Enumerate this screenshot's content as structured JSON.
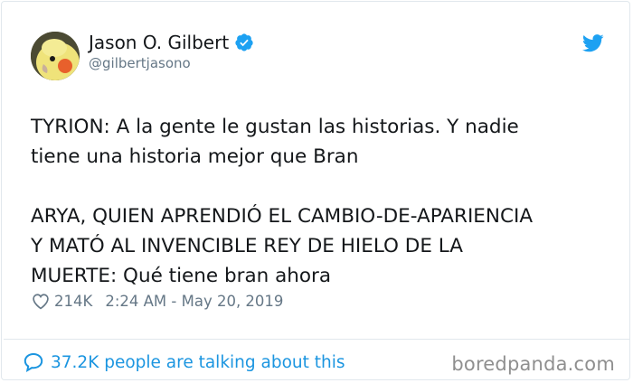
{
  "author": {
    "name": "Jason O. Gilbert",
    "handle": "@gilbertjasono",
    "avatar_icon": "cockatiel-avatar",
    "verified_icon": "verified-badge-icon",
    "verified_color": "#1da1f2"
  },
  "platform_icon": "twitter-bird-icon",
  "tweet": {
    "lines_1": [
      "TYRION: A la gente le gustan las historias. Y nadie",
      "tiene una historia mejor que Bran"
    ],
    "lines_2": [
      "ARYA, QUIEN APRENDIÓ EL CAMBIO-DE-APARIENCIA",
      "Y MATÓ AL INVENCIBLE REY DE HIELO DE LA",
      "MUERTE: Qué tiene bran ahora"
    ]
  },
  "meta": {
    "likes": "214K",
    "timestamp": "2:24 AM - May 20, 2019"
  },
  "footer": {
    "talking_text": "37.2K people are talking about this",
    "link_color": "#1b95e0"
  },
  "watermark": "boredpanda.com"
}
